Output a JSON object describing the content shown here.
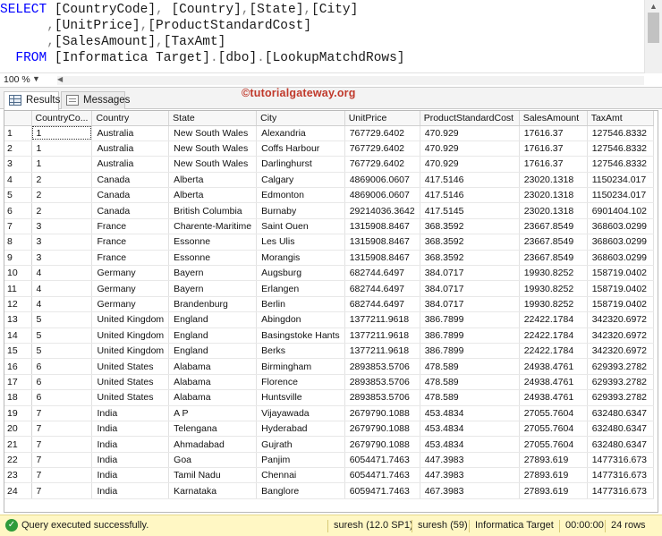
{
  "editor": {
    "lines": [
      [
        [
          "kw",
          "SELECT "
        ],
        [
          "id",
          "[CountryCode]"
        ],
        [
          "pn",
          ", "
        ],
        [
          "id",
          "[Country]"
        ],
        [
          "pn",
          ","
        ],
        [
          "id",
          "[State]"
        ],
        [
          "pn",
          ","
        ],
        [
          "id",
          "[City]"
        ]
      ],
      [
        [
          "id",
          "      "
        ],
        [
          "pn",
          ","
        ],
        [
          "id",
          "[UnitPrice]"
        ],
        [
          "pn",
          ","
        ],
        [
          "id",
          "[ProductStandardCost]"
        ]
      ],
      [
        [
          "id",
          "      "
        ],
        [
          "pn",
          ","
        ],
        [
          "id",
          "[SalesAmount]"
        ],
        [
          "pn",
          ","
        ],
        [
          "id",
          "[TaxAmt]"
        ]
      ],
      [
        [
          "kw",
          "  FROM "
        ],
        [
          "id",
          "[Informatica Target]"
        ],
        [
          "pn",
          "."
        ],
        [
          "id",
          "[dbo]"
        ],
        [
          "pn",
          "."
        ],
        [
          "id",
          "[LookupMatchdRows]"
        ]
      ]
    ],
    "zoom": "100 %"
  },
  "tabs": {
    "results": "Results",
    "messages": "Messages"
  },
  "watermark": "©tutorialgateway.org",
  "grid": {
    "columns": [
      "CountryCo...",
      "Country",
      "State",
      "City",
      "UnitPrice",
      "ProductStandardCost",
      "SalesAmount",
      "TaxAmt"
    ],
    "rows": [
      [
        "1",
        "Australia",
        "New South Wales",
        "Alexandria",
        "767729.6402",
        "470.929",
        "17616.37",
        "127546.8332"
      ],
      [
        "1",
        "Australia",
        "New South Wales",
        "Coffs Harbour",
        "767729.6402",
        "470.929",
        "17616.37",
        "127546.8332"
      ],
      [
        "1",
        "Australia",
        "New South Wales",
        "Darlinghurst",
        "767729.6402",
        "470.929",
        "17616.37",
        "127546.8332"
      ],
      [
        "2",
        "Canada",
        "Alberta",
        "Calgary",
        "4869006.0607",
        "417.5146",
        "23020.1318",
        "1150234.017"
      ],
      [
        "2",
        "Canada",
        "Alberta",
        "Edmonton",
        "4869006.0607",
        "417.5146",
        "23020.1318",
        "1150234.017"
      ],
      [
        "2",
        "Canada",
        "British Columbia",
        "Burnaby",
        "29214036.3642",
        "417.5145",
        "23020.1318",
        "6901404.102"
      ],
      [
        "3",
        "France",
        "Charente-Maritime",
        "Saint Ouen",
        "1315908.8467",
        "368.3592",
        "23667.8549",
        "368603.0299"
      ],
      [
        "3",
        "France",
        "Essonne",
        "Les Ulis",
        "1315908.8467",
        "368.3592",
        "23667.8549",
        "368603.0299"
      ],
      [
        "3",
        "France",
        "Essonne",
        "Morangis",
        "1315908.8467",
        "368.3592",
        "23667.8549",
        "368603.0299"
      ],
      [
        "4",
        "Germany",
        "Bayern",
        "Augsburg",
        "682744.6497",
        "384.0717",
        "19930.8252",
        "158719.0402"
      ],
      [
        "4",
        "Germany",
        "Bayern",
        "Erlangen",
        "682744.6497",
        "384.0717",
        "19930.8252",
        "158719.0402"
      ],
      [
        "4",
        "Germany",
        "Brandenburg",
        "Berlin",
        "682744.6497",
        "384.0717",
        "19930.8252",
        "158719.0402"
      ],
      [
        "5",
        "United Kingdom",
        "England",
        "Abingdon",
        "1377211.9618",
        "386.7899",
        "22422.1784",
        "342320.6972"
      ],
      [
        "5",
        "United Kingdom",
        "England",
        "Basingstoke Hants",
        "1377211.9618",
        "386.7899",
        "22422.1784",
        "342320.6972"
      ],
      [
        "5",
        "United Kingdom",
        "England",
        "Berks",
        "1377211.9618",
        "386.7899",
        "22422.1784",
        "342320.6972"
      ],
      [
        "6",
        "United States",
        "Alabama",
        "Birmingham",
        "2893853.5706",
        "478.589",
        "24938.4761",
        "629393.2782"
      ],
      [
        "6",
        "United States",
        "Alabama",
        "Florence",
        "2893853.5706",
        "478.589",
        "24938.4761",
        "629393.2782"
      ],
      [
        "6",
        "United States",
        "Alabama",
        "Huntsville",
        "2893853.5706",
        "478.589",
        "24938.4761",
        "629393.2782"
      ],
      [
        "7",
        "India",
        "A P",
        "Vijayawada",
        "2679790.1088",
        "453.4834",
        "27055.7604",
        "632480.6347"
      ],
      [
        "7",
        "India",
        "Telengana",
        "Hyderabad",
        "2679790.1088",
        "453.4834",
        "27055.7604",
        "632480.6347"
      ],
      [
        "7",
        "India",
        "Ahmadabad",
        "Gujrath",
        "2679790.1088",
        "453.4834",
        "27055.7604",
        "632480.6347"
      ],
      [
        "7",
        "India",
        "Goa",
        "Panjim",
        "6054471.7463",
        "447.3983",
        "27893.619",
        "1477316.673"
      ],
      [
        "7",
        "India",
        "Tamil Nadu",
        "Chennai",
        "6054471.7463",
        "447.3983",
        "27893.619",
        "1477316.673"
      ],
      [
        "7",
        "India",
        "Karnataka",
        "Banglore",
        "6059471.7463",
        "467.3983",
        "27893.619",
        "1477316.673"
      ]
    ]
  },
  "status": {
    "message": "Query executed successfully.",
    "server": "suresh (12.0 SP1)",
    "user": "suresh (59)",
    "database": "Informatica Target",
    "elapsed": "00:00:00",
    "rows": "24 rows"
  },
  "colors": {
    "keyword": "#0000ff",
    "status_bg": "#fff7c4",
    "ok_icon": "#2e9b3a",
    "watermark": "#c0392b"
  }
}
